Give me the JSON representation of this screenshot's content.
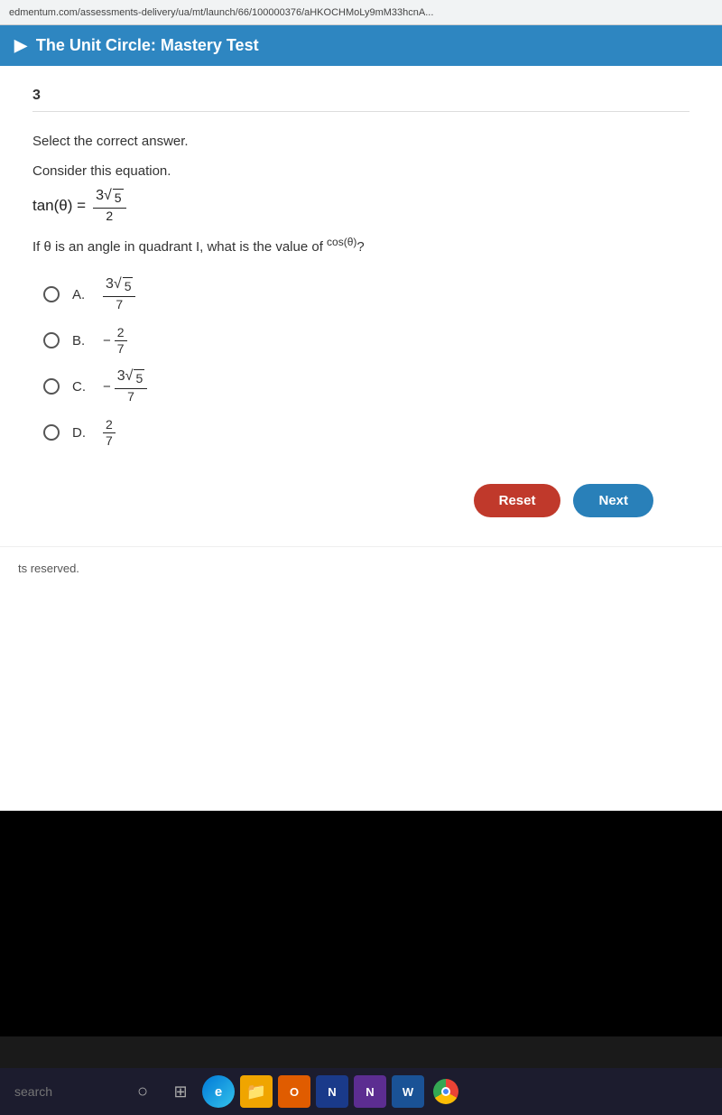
{
  "urlBar": {
    "text": "edmentum.com/assessments-delivery/ua/mt/launch/66/100000376/aHKOCHMoLy9mM33hcnA..."
  },
  "titleBar": {
    "title": "The Unit Circle: Mastery Test"
  },
  "question": {
    "number": "3",
    "instruction": "Select the correct answer.",
    "consider": "Consider this equation.",
    "equation": "tan(θ) =",
    "equationFraction": {
      "num": "3√5",
      "den": "2"
    },
    "questionText": "If θ is an angle in quadrant I, what is the value of",
    "questionTextEnd": "cos(θ)?",
    "choices": [
      {
        "label": "A.",
        "value": "3√5",
        "valueDen": "7",
        "negative": false,
        "hasSqrt": true
      },
      {
        "label": "B.",
        "value": "2",
        "valueDen": "7",
        "negative": true,
        "hasSqrt": false
      },
      {
        "label": "C.",
        "value": "3√5",
        "valueDen": "7",
        "negative": true,
        "hasSqrt": true
      },
      {
        "label": "D.",
        "value": "2",
        "valueDen": "7",
        "negative": false,
        "hasSqrt": false
      }
    ]
  },
  "buttons": {
    "reset": "Reset",
    "next": "Next"
  },
  "footer": {
    "text": "ts reserved."
  },
  "taskbar": {
    "searchPlaceholder": "search",
    "icons": [
      {
        "name": "windows-start",
        "label": "○"
      },
      {
        "name": "task-view",
        "label": "⊞"
      },
      {
        "name": "edge",
        "label": "e"
      },
      {
        "name": "folder",
        "label": "📁"
      },
      {
        "name": "app-o",
        "label": "O"
      },
      {
        "name": "app-n1",
        "label": "N"
      },
      {
        "name": "app-n2",
        "label": "N"
      },
      {
        "name": "app-w",
        "label": "W"
      }
    ]
  }
}
